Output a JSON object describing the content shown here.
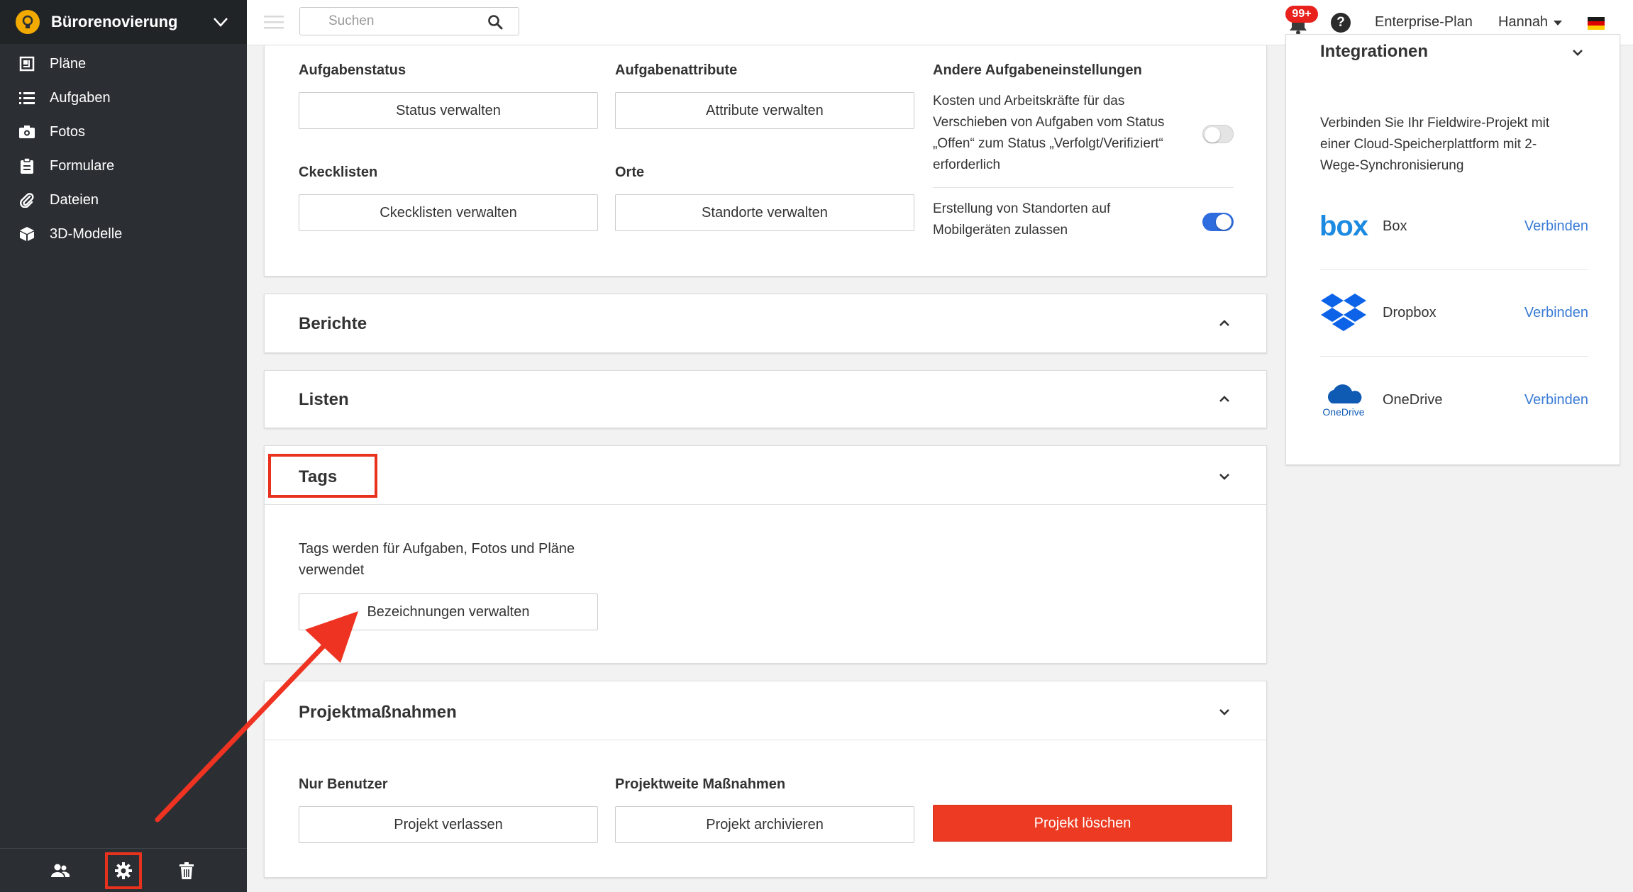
{
  "sidebar": {
    "project_name": "Bürorenovierung",
    "items": [
      {
        "label": "Pläne",
        "icon": "plans-icon"
      },
      {
        "label": "Aufgaben",
        "icon": "list-icon"
      },
      {
        "label": "Fotos",
        "icon": "camera-icon"
      },
      {
        "label": "Formulare",
        "icon": "clipboard-icon"
      },
      {
        "label": "Dateien",
        "icon": "paperclip-icon"
      },
      {
        "label": "3D-Modelle",
        "icon": "cube-icon"
      }
    ],
    "bottom": [
      {
        "icon": "users-icon"
      },
      {
        "icon": "gear-icon",
        "highlighted": true
      },
      {
        "icon": "trash-icon"
      }
    ]
  },
  "topbar": {
    "search_placeholder": "Suchen",
    "notifications_badge": "99+",
    "help": "?",
    "plan": "Enterprise-Plan",
    "user": "Hannah",
    "flag": "german-flag-icon"
  },
  "task_settings": {
    "status_label": "Aufgabenstatus",
    "status_button": "Status verwalten",
    "attributes_label": "Aufgabenattribute",
    "attributes_button": "Attribute verwalten",
    "other_label": "Andere Aufgabeneinstellungen",
    "setting1_lines": [
      "Kosten und Arbeitskräfte für das",
      "Verschieben von Aufgaben vom Status",
      "„Offen“ zum Status „Verfolgt/Verifiziert“",
      "erforderlich"
    ],
    "setting1_on": false,
    "checklists_label": "Ckecklisten",
    "checklists_button": "Ckecklisten verwalten",
    "locations_label": "Orte",
    "locations_button": "Standorte verwalten",
    "setting2_lines": [
      "Erstellung von Standorten auf",
      "Mobilgeräten zulassen"
    ],
    "setting2_on": true
  },
  "reports": {
    "title": "Berichte"
  },
  "lists": {
    "title": "Listen"
  },
  "tags": {
    "title": "Tags",
    "desc_lines": [
      "Tags werden für Aufgaben, Fotos und Pläne",
      "verwendet"
    ],
    "button": "Bezeichnungen verwalten"
  },
  "project_actions": {
    "title": "Projektmaßnahmen",
    "users_only_label": "Nur Benutzer",
    "leave_button": "Projekt verlassen",
    "projectwide_label": "Projektweite Maßnahmen",
    "archive_button": "Projekt archivieren",
    "delete_button": "Projekt löschen"
  },
  "integrations": {
    "title": "Integrationen",
    "desc_lines": [
      "Verbinden Sie Ihr Fieldwire-Projekt mit",
      "einer Cloud-Speicherplattform mit 2-",
      "Wege-Synchronisierung"
    ],
    "connect_label": "Verbinden",
    "services": [
      {
        "name": "Box",
        "logo_text": "box"
      },
      {
        "name": "Dropbox"
      },
      {
        "name": "OneDrive",
        "logo_text": "OneDrive"
      }
    ]
  },
  "colors": {
    "sidebar_bg": "#2b2f33",
    "accent_blue": "#3a7bd5",
    "danger_red": "#ec3b22",
    "annotation_red": "#e8321e"
  }
}
